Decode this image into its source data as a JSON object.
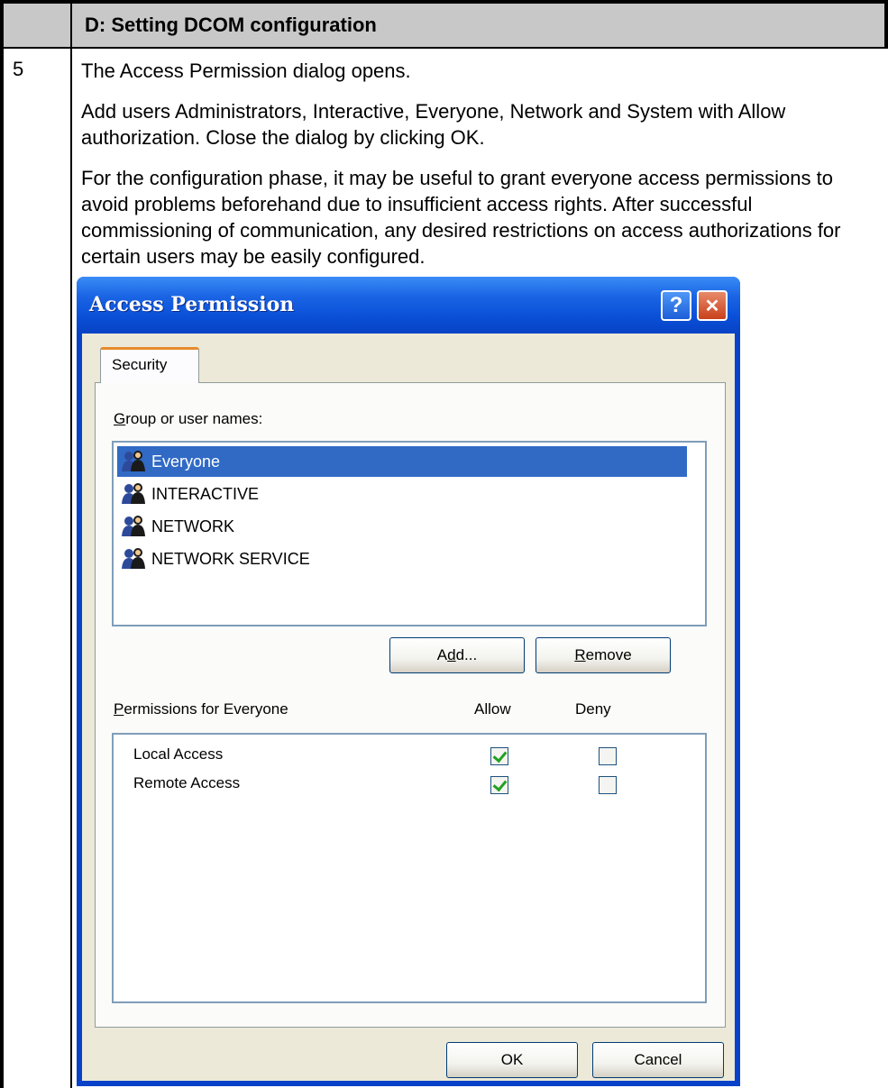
{
  "document": {
    "section_title": "D: Setting DCOM configuration",
    "step_number": "5",
    "paragraphs": [
      "The Access Permission dialog opens.",
      "Add users Administrators, Interactive, Everyone, Network and System with Allow authorization. Close the dialog by clicking OK.",
      "For the configuration phase, it may be useful to grant everyone access permissions to avoid problems beforehand due to insufficient access rights. After successful commissioning of communication, any desired restrictions on access authorizations for certain users may be easily configured."
    ]
  },
  "dialog": {
    "title": "Access Permission",
    "help_glyph": "?",
    "close_glyph": "✕",
    "tab_label": "Security",
    "group_label": "Group or user names:",
    "users": [
      {
        "name": "Everyone",
        "selected": true
      },
      {
        "name": "INTERACTIVE",
        "selected": false
      },
      {
        "name": "NETWORK",
        "selected": false
      },
      {
        "name": "NETWORK SERVICE",
        "selected": false
      }
    ],
    "add_button": "Add...",
    "remove_button": "Remove",
    "permissions_label": "Permissions for Everyone",
    "allow_header": "Allow",
    "deny_header": "Deny",
    "permissions": [
      {
        "name": "Local Access",
        "allow": true,
        "deny": false
      },
      {
        "name": "Remote Access",
        "allow": true,
        "deny": false
      }
    ],
    "ok_button": "OK",
    "cancel_button": "Cancel",
    "user_icon": "users-group-icon"
  }
}
